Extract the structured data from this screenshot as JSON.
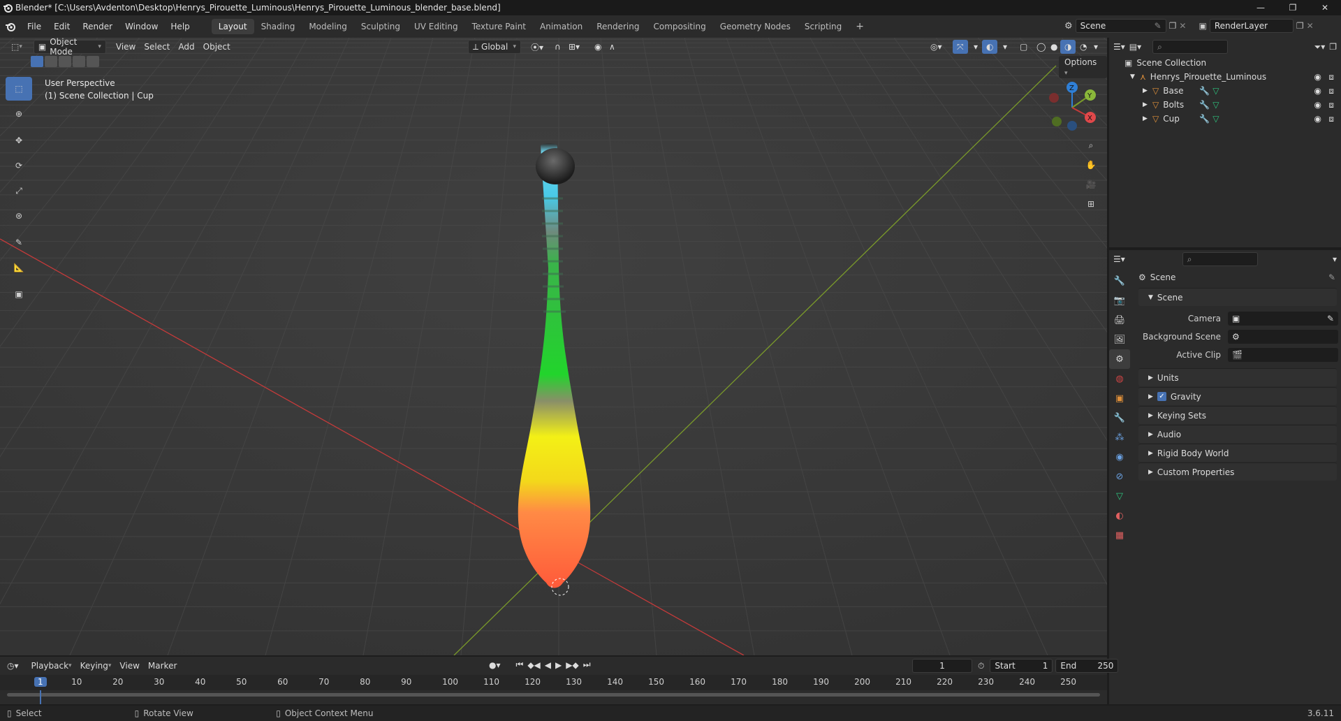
{
  "window": {
    "title": "Blender* [C:\\Users\\Avdenton\\Desktop\\Henrys_Pirouette_Luminous\\Henrys_Pirouette_Luminous_blender_base.blend]",
    "minimize": "—",
    "maximize": "❐",
    "close": "✕"
  },
  "menu": {
    "items": [
      "File",
      "Edit",
      "Render",
      "Window",
      "Help"
    ],
    "workspaces": [
      "Layout",
      "Shading",
      "Modeling",
      "Sculpting",
      "UV Editing",
      "Texture Paint",
      "Animation",
      "Rendering",
      "Compositing",
      "Geometry Nodes",
      "Scripting"
    ],
    "add_workspace": "+",
    "scene": "Scene",
    "view_layer": "RenderLayer"
  },
  "viewport": {
    "mode": "Object Mode",
    "menus": [
      "View",
      "Select",
      "Add",
      "Object"
    ],
    "orientation": "Global",
    "options": "Options",
    "perspective": "User Perspective",
    "collection_info": "(1) Scene Collection | Cup",
    "gizmo": {
      "x": "X",
      "y": "Y",
      "z": "Z"
    }
  },
  "outliner": {
    "root": "Scene Collection",
    "collection": "Henrys_Pirouette_Luminous",
    "objects": [
      "Base",
      "Bolts",
      "Cup"
    ]
  },
  "properties": {
    "context": "Scene",
    "panel": "Scene",
    "fields": [
      {
        "label": "Camera",
        "value": ""
      },
      {
        "label": "Background Scene",
        "value": ""
      },
      {
        "label": "Active Clip",
        "value": ""
      }
    ],
    "collapsed_panels": [
      "Units",
      "Gravity",
      "Keying Sets",
      "Audio",
      "Rigid Body World",
      "Custom Properties"
    ],
    "gravity_checked": true
  },
  "timeline": {
    "menus": [
      "Playback",
      "Keying",
      "View",
      "Marker"
    ],
    "current_frame": "1",
    "start_label": "Start",
    "start": "1",
    "end_label": "End",
    "end": "250",
    "ruler": [
      "1",
      "10",
      "20",
      "30",
      "40",
      "50",
      "60",
      "70",
      "80",
      "90",
      "100",
      "110",
      "120",
      "130",
      "140",
      "150",
      "160",
      "170",
      "180",
      "190",
      "200",
      "210",
      "220",
      "230",
      "240",
      "250"
    ]
  },
  "status": {
    "select": "Select",
    "rotate": "Rotate View",
    "context_menu": "Object Context Menu",
    "version": "3.6.11"
  },
  "colors": {
    "accent": "#4772b3",
    "x_axis": "#c43a3a",
    "y_axis": "#7a9a2a",
    "z_axis": "#2f7fd6"
  }
}
